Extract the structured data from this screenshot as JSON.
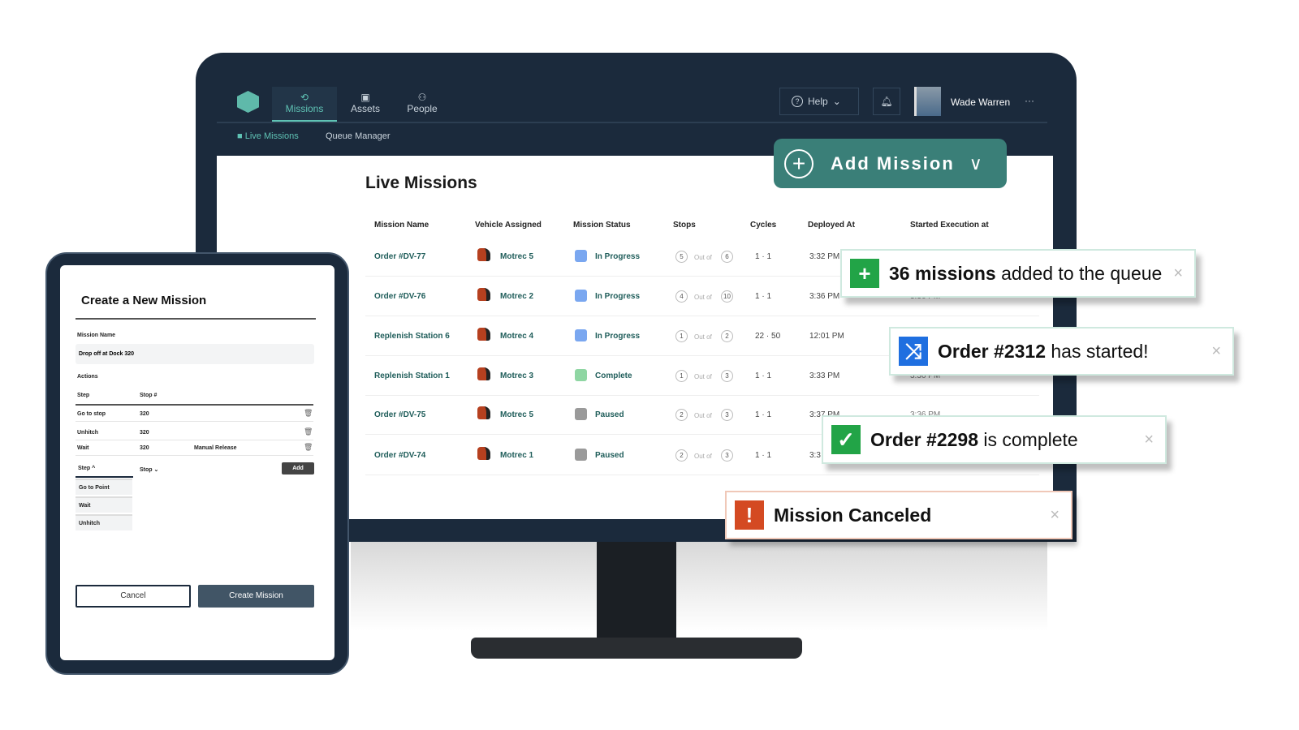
{
  "nav": {
    "items": [
      {
        "label": "Missions",
        "icon": "missions-icon",
        "active": true
      },
      {
        "label": "Assets",
        "icon": "assets-icon"
      },
      {
        "label": "People",
        "icon": "people-icon"
      }
    ],
    "help_label": "Help",
    "user_name": "Wade Warren",
    "more": "···",
    "subnav": [
      {
        "label": "Live Missions",
        "active": true
      },
      {
        "label": "Queue Manager"
      }
    ]
  },
  "page_title": "Live Missions",
  "add_mission_label": "Add Mission",
  "table": {
    "headers": [
      "Mission Name",
      "Vehicle Assigned",
      "Mission Status",
      "Stops",
      "Cycles",
      "Deployed At",
      "Started Execution at"
    ],
    "out_of": "Out of",
    "rows": [
      {
        "name": "Order #DV-77",
        "vehicle": "Motrec 5",
        "status": "In Progress",
        "stop": "5",
        "stops_total": "6",
        "cycles": "1 · 1",
        "deployed": "3:32 PM",
        "started": ""
      },
      {
        "name": "Order #DV-76",
        "vehicle": "Motrec 2",
        "status": "In Progress",
        "stop": "4",
        "stops_total": "10",
        "cycles": "1 · 1",
        "deployed": "3:36 PM",
        "started": "3:36 PM"
      },
      {
        "name": "Replenish Station 6",
        "vehicle": "Motrec 4",
        "status": "In Progress",
        "stop": "1",
        "stops_total": "2",
        "cycles": "22 · 50",
        "deployed": "12:01 PM",
        "started": ""
      },
      {
        "name": "Replenish Station 1",
        "vehicle": "Motrec 3",
        "status": "Complete",
        "stop": "1",
        "stops_total": "3",
        "cycles": "1 · 1",
        "deployed": "3:33 PM",
        "started": "3:36 PM"
      },
      {
        "name": "Order #DV-75",
        "vehicle": "Motrec 5",
        "status": "Paused",
        "stop": "2",
        "stops_total": "3",
        "cycles": "1 · 1",
        "deployed": "3:37 PM",
        "started": "3:36 PM"
      },
      {
        "name": "Order #DV-74",
        "vehicle": "Motrec 1",
        "status": "Paused",
        "stop": "2",
        "stops_total": "3",
        "cycles": "1 · 1",
        "deployed": "3:3",
        "started": ""
      }
    ]
  },
  "status_colors": {
    "In Progress": "#7aa7f0",
    "Complete": "#8fd6a3",
    "Paused": "#9a9a9a"
  },
  "toasts": [
    {
      "bold": "36 missions",
      "rest": " added to the queue",
      "icon": "plus-icon",
      "color": "#22a447"
    },
    {
      "bold": "Order #2312",
      "rest": " has started!",
      "icon": "shuffle-icon",
      "color": "#1f6fe0"
    },
    {
      "bold": "Order #2298",
      "rest": " is complete",
      "icon": "check-icon",
      "color": "#22a447"
    },
    {
      "bold": "Mission Canceled",
      "rest": "",
      "icon": "alert-icon",
      "color": "#d44a22"
    }
  ],
  "tablet": {
    "title": "Create a New Mission",
    "mission_name_label": "Mission Name",
    "mission_name_value": "Drop off at Dock 320",
    "actions_label": "Actions",
    "col_step": "Step",
    "col_stop": "Stop #",
    "steps": [
      {
        "step": "Go to stop",
        "stop": "320",
        "extra": ""
      },
      {
        "step": "Unhitch",
        "stop": "320",
        "extra": ""
      },
      {
        "step": "Wait",
        "stop": "320",
        "extra": "Manual Release"
      }
    ],
    "step_select": "Step",
    "stop_select": "Stop",
    "add_label": "Add",
    "dropdown": [
      "Go to Point",
      "Wait",
      "Unhitch"
    ],
    "cancel_label": "Cancel",
    "create_label": "Create Mission"
  }
}
